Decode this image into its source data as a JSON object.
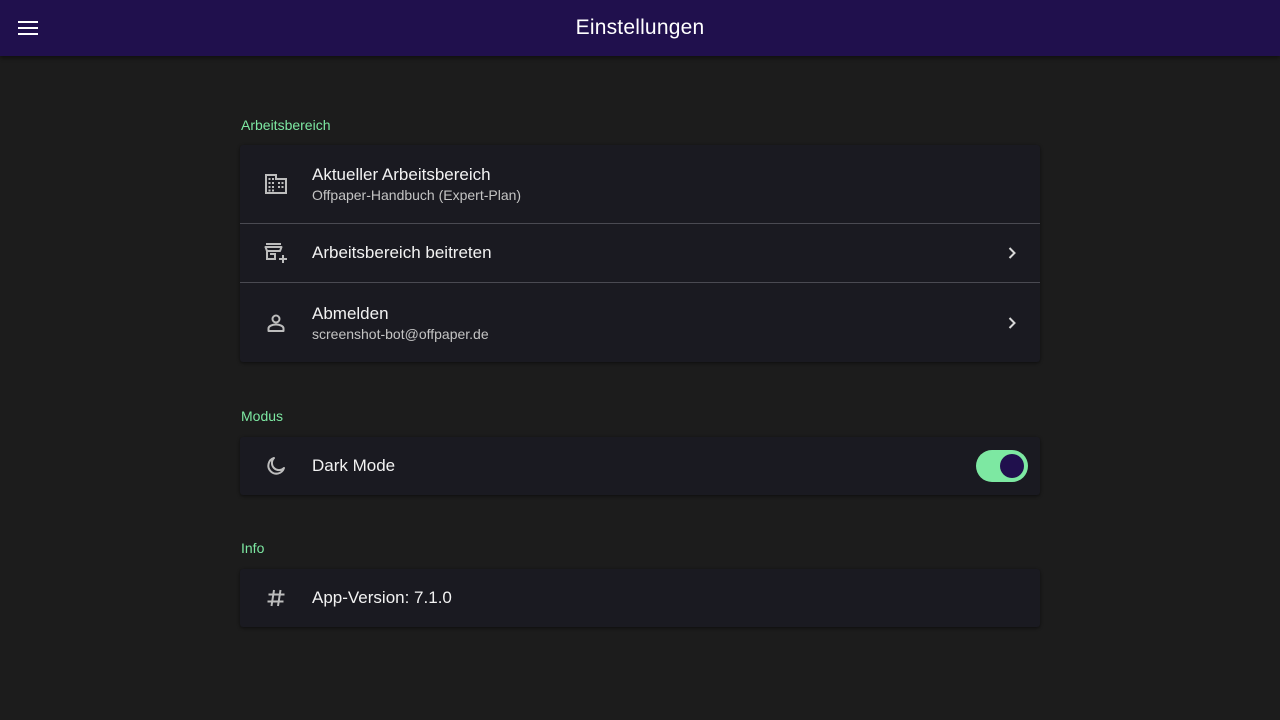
{
  "appbar": {
    "title": "Einstellungen",
    "menu_icon": "menu-icon"
  },
  "sections": {
    "workspace": {
      "title": "Arbeitsbereich",
      "current": {
        "label": "Aktueller Arbeitsbereich",
        "value": "Offpaper-Handbuch (Expert-Plan)",
        "icon": "building-icon"
      },
      "join": {
        "label": "Arbeitsbereich beitreten",
        "icon": "add-business-icon"
      },
      "logout": {
        "label": "Abmelden",
        "value": "screenshot-bot@offpaper.de",
        "icon": "person-icon"
      }
    },
    "mode": {
      "title": "Modus",
      "dark_mode": {
        "label": "Dark Mode",
        "icon": "moon-icon",
        "enabled": true
      }
    },
    "info": {
      "title": "Info",
      "version": {
        "label": "App-Version: 7.1.0",
        "icon": "hash-icon"
      }
    }
  },
  "colors": {
    "appbar_bg": "#20104d",
    "accent": "#7de8a2",
    "page_bg": "#1c1c1c",
    "card_bg": "#1a1a21"
  }
}
